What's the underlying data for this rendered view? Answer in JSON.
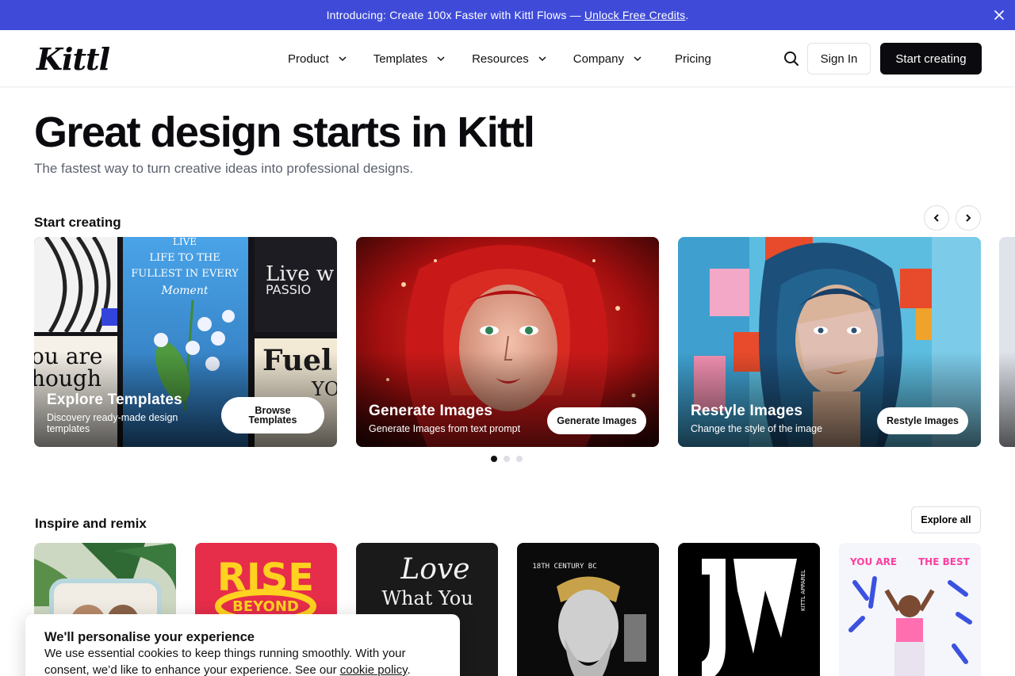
{
  "announcement": {
    "text": "Introducing: Create 100x Faster with Kittl Flows —",
    "link": "Unlock Free Credits",
    "suffix": ".",
    "bg_color": "#3f4bd8"
  },
  "header": {
    "logo": "Kittl",
    "nav": [
      {
        "label": "Product",
        "has_dropdown": true
      },
      {
        "label": "Templates",
        "has_dropdown": true
      },
      {
        "label": "Resources",
        "has_dropdown": true
      },
      {
        "label": "Company",
        "has_dropdown": true
      },
      {
        "label": "Pricing",
        "has_dropdown": false
      }
    ],
    "sign_in": "Sign In",
    "start_creating": "Start creating"
  },
  "hero": {
    "title": "Great design starts in Kittl",
    "subtitle": "The fastest way to turn creative ideas into professional designs."
  },
  "start_creating": {
    "title": "Start creating",
    "cards": [
      {
        "title": "Explore Templates",
        "description": "Discovery ready-made design templates",
        "button": "Browse Templates"
      },
      {
        "title": "Generate Images",
        "description": "Generate Images from text prompt",
        "button": "Generate Images"
      },
      {
        "title": "Restyle Images",
        "description": "Change the style of the image",
        "button": "Restyle Images"
      }
    ],
    "pagination": {
      "pages": 3,
      "active": 1
    }
  },
  "inspire": {
    "title": "Inspire and remix",
    "explore_all": "Explore all",
    "tile_texts": {
      "rise": "RISE",
      "beyond": "BEYOND",
      "love": "Love",
      "what_you": "What You",
      "century": "18TH CENTURY BC",
      "apparel": "KITTL APPAREL",
      "you_are": "YOU ARE",
      "the_best": "THE BEST"
    }
  },
  "cookie": {
    "title": "We'll personalise your experience",
    "text": "We use essential cookies to keep things running smoothly. With your consent, we’d like to enhance your experience. See our",
    "link": "cookie policy",
    "suffix": "."
  },
  "colors": {
    "accent": "#3f4bd8",
    "primary_button": "#0b0b0f"
  }
}
